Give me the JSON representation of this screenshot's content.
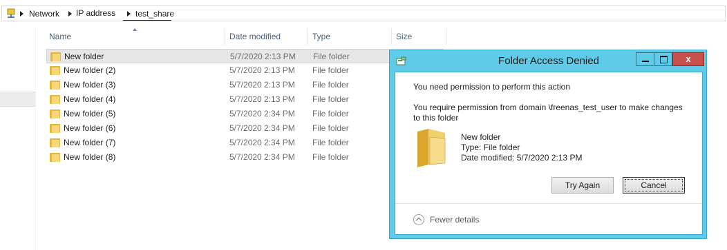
{
  "breadcrumb": {
    "items": [
      "Network",
      "IP address",
      "test_share"
    ]
  },
  "columns": {
    "name": "Name",
    "date_modified": "Date modified",
    "type": "Type",
    "size": "Size"
  },
  "files": [
    {
      "name": "New folder",
      "date": "5/7/2020 2:13 PM",
      "type": "File folder"
    },
    {
      "name": "New folder (2)",
      "date": "5/7/2020 2:13 PM",
      "type": "File folder"
    },
    {
      "name": "New folder (3)",
      "date": "5/7/2020 2:13 PM",
      "type": "File folder"
    },
    {
      "name": "New folder (4)",
      "date": "5/7/2020 2:13 PM",
      "type": "File folder"
    },
    {
      "name": "New folder (5)",
      "date": "5/7/2020 2:34 PM",
      "type": "File folder"
    },
    {
      "name": "New folder (6)",
      "date": "5/7/2020 2:34 PM",
      "type": "File folder"
    },
    {
      "name": "New folder (7)",
      "date": "5/7/2020 2:34 PM",
      "type": "File folder"
    },
    {
      "name": "New folder (8)",
      "date": "5/7/2020 2:34 PM",
      "type": "File folder"
    }
  ],
  "dialog": {
    "title": "Folder Access Denied",
    "message": "You need permission to perform this action",
    "detail": "You require permission from    domain   \\freenas_test_user to make changes to this folder",
    "item_name": "New folder",
    "item_type": "Type: File folder",
    "item_date": "Date modified: 5/7/2020 2:13 PM",
    "try_again": "Try Again",
    "cancel": "Cancel",
    "fewer_details": "Fewer details",
    "close_glyph": "x"
  },
  "colors": {
    "dialog_frame": "#5fcbe9",
    "close_button": "#c7504a",
    "header_text": "#4c607a"
  }
}
